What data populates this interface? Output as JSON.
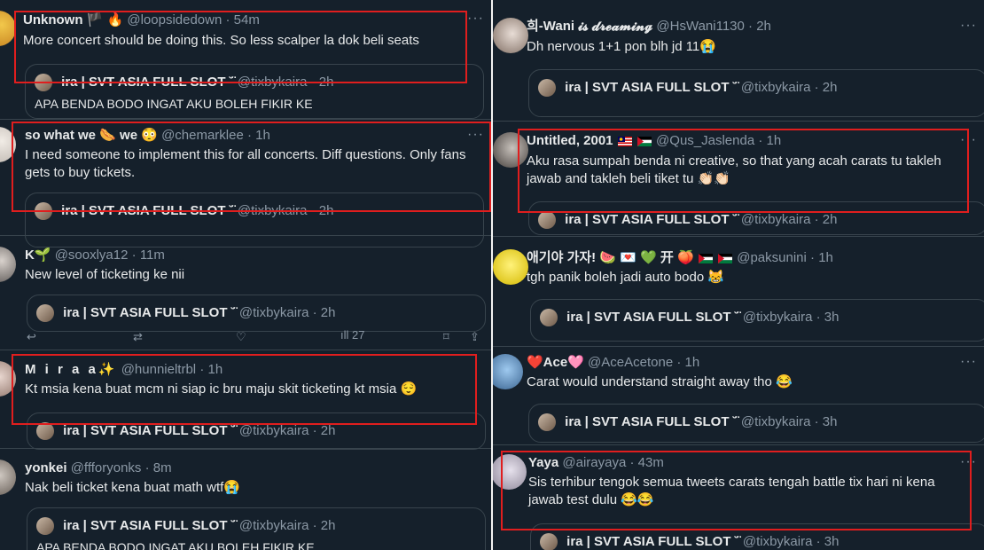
{
  "quote_tweet": {
    "name": "ira | SVT ASIA FULL SLOT ˘̈",
    "handle": "@tixbykaira",
    "text": "APA BENDA BODO INGAT AKU BOLEH FIKIR KE"
  },
  "left_column": [
    {
      "name": "Unknown 🏴 🔥",
      "handle": "@loopsidedown",
      "time": "54m",
      "text_lines": [
        "More concert should be doing this. So less scalper la dok beli seats"
      ],
      "quote_time": "2h"
    },
    {
      "name": "so what we 🌭 we 😳",
      "handle": "@chemarklee",
      "time": "1h",
      "text_lines": [
        "I need someone to implement this for all concerts. Diff questions. Only fans",
        "gets to buy tickets."
      ],
      "quote_time": "2h"
    },
    {
      "name": "K🌱",
      "handle": "@sooxlya12",
      "time": "11m",
      "text_lines": [
        "New level of ticketing ke nii"
      ],
      "quote_time": "2h",
      "views": "27"
    },
    {
      "name": "M i r a a✨",
      "handle": "@hunnieltrbl",
      "time": "1h",
      "text_lines": [
        "Kt msia kena buat mcm ni siap ic bru maju skit ticketing kt msia 😌"
      ],
      "quote_time": "2h"
    },
    {
      "name": "yonkei",
      "handle": "@ffforyonks",
      "time": "8m",
      "text_lines": [
        "Nak beli ticket kena buat math wtf😭"
      ],
      "quote_time": "2h"
    }
  ],
  "right_column": [
    {
      "name": "희-Wani 𝓲𝓼 𝓭𝓻𝓮𝓪𝓶𝓲𝓷𝓰",
      "handle": "@HsWani1130",
      "time": "2h",
      "text_lines": [
        "Dh nervous 1+1 pon blh jd 11😭"
      ],
      "quote_time": "2h"
    },
    {
      "name": "Untitled, 2001",
      "handle": "@Qus_Jaslenda",
      "time": "1h",
      "text_lines": [
        "Aku rasa sumpah benda ni creative, so that yang acah carats tu takleh",
        "jawab and takleh beli tiket tu 👏🏻👏🏻"
      ],
      "quote_time": "2h"
    },
    {
      "name": "애기야 가자! 🍉 💌 💚 开 🍑",
      "handle": "@paksunini",
      "time": "1h",
      "text_lines": [
        "tgh panik boleh jadi auto bodo 😹"
      ],
      "quote_time": "3h"
    },
    {
      "name": "❤️Ace🩷",
      "handle": "@AceAcetone",
      "time": "1h",
      "text_lines": [
        "Carat would understand straight away tho 😂"
      ],
      "quote_time": "3h"
    },
    {
      "name": "Yaya",
      "handle": "@airayaya",
      "time": "43m",
      "text_lines": [
        "Sis terhibur tengok semua tweets carats tengah battle tix hari ni kena",
        "jawab test dulu 😂😂"
      ],
      "quote_time": "3h"
    }
  ],
  "ui": {
    "more": "···",
    "dot": "·"
  },
  "colors": {
    "background": "#15202b",
    "highlight": "#e01e1e",
    "muted": "#8b98a5"
  }
}
